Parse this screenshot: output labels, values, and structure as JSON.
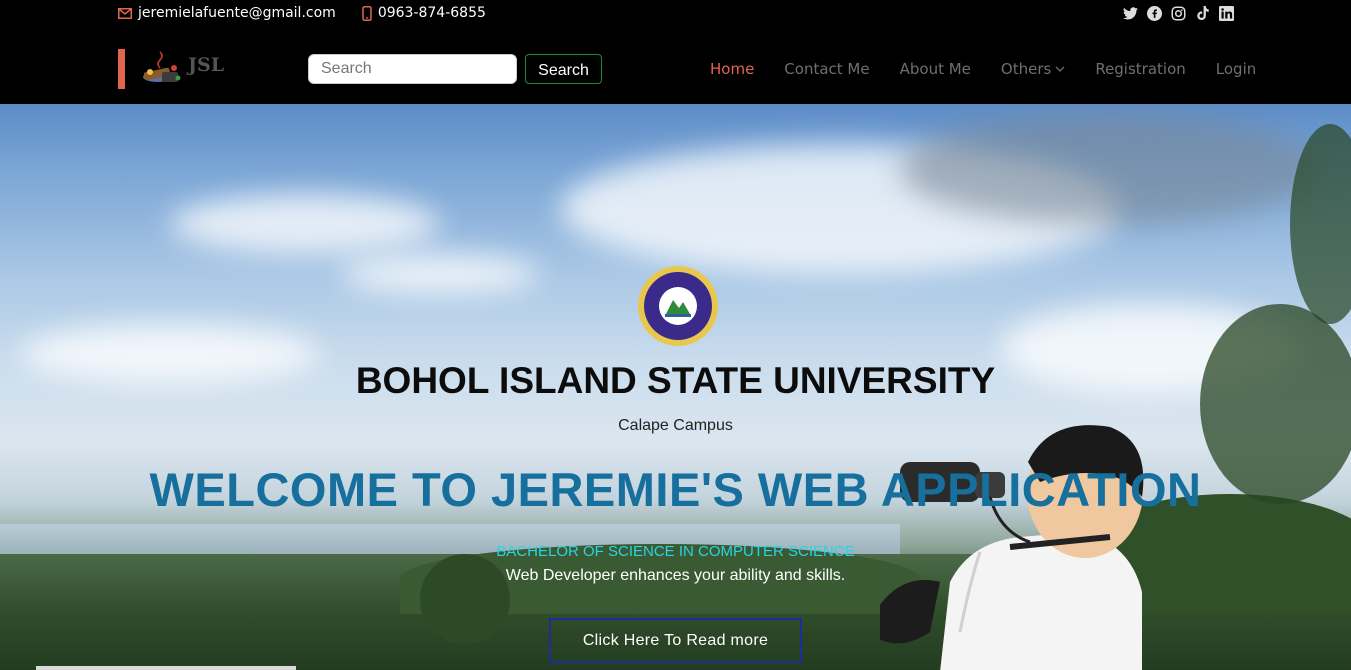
{
  "topbar": {
    "email": "jeremielafuente@gmail.com",
    "phone": "0963-874-6855",
    "social": [
      "twitter-icon",
      "facebook-icon",
      "instagram-icon",
      "tiktok-icon",
      "linkedin-icon"
    ]
  },
  "header": {
    "logo_text": "JSL",
    "search_placeholder": "Search",
    "search_button": "Search",
    "nav": {
      "home": "Home",
      "contact": "Contact Me",
      "about": "About Me",
      "others": "Others",
      "registration": "Registration",
      "login": "Login"
    }
  },
  "hero": {
    "university": "BOHOL ISLAND STATE UNIVERSITY",
    "campus": "Calape Campus",
    "welcome": "WELCOME TO JEREMIE'S WEB APPLICATION",
    "course": "BACHELOR OF SCIENCE IN COMPUTER SCIENCE",
    "tagline": "Web Developer enhances your ability and skills.",
    "cta": "Click Here To Read more"
  },
  "colors": {
    "accent": "#e2664d",
    "welcome": "#166f9c",
    "course": "#2ad4e2",
    "cta_border": "#1b2f9a"
  }
}
